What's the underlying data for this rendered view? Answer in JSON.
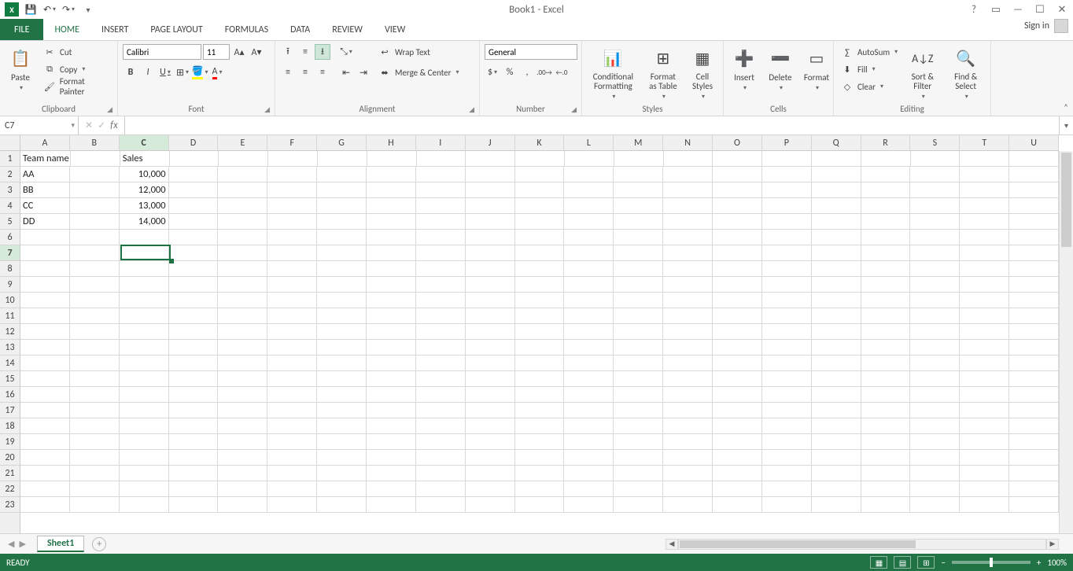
{
  "title": "Book1 - Excel",
  "qat": {
    "save": "💾",
    "undo": "↶",
    "redo": "↷"
  },
  "winbtns": {
    "help": "?",
    "ribbonopts": "▭",
    "min": "—",
    "max": "☐",
    "close": "✕"
  },
  "tabs": {
    "file": "FILE",
    "list": [
      "HOME",
      "INSERT",
      "PAGE LAYOUT",
      "FORMULAS",
      "DATA",
      "REVIEW",
      "VIEW"
    ],
    "active": "HOME"
  },
  "signin": "Sign in",
  "ribbon": {
    "clipboard": {
      "label": "Clipboard",
      "paste": "Paste",
      "cut": "Cut",
      "copy": "Copy",
      "painter": "Format Painter"
    },
    "font": {
      "label": "Font",
      "name": "Calibri",
      "size": "11",
      "bold": "B",
      "italic": "I",
      "underline": "U"
    },
    "alignment": {
      "label": "Alignment",
      "wrap": "Wrap Text",
      "merge": "Merge & Center"
    },
    "number": {
      "label": "Number",
      "format": "General"
    },
    "styles": {
      "label": "Styles",
      "cond": "Conditional Formatting",
      "table": "Format as Table",
      "cell": "Cell Styles"
    },
    "cells": {
      "label": "Cells",
      "insert": "Insert",
      "delete": "Delete",
      "format": "Format"
    },
    "editing": {
      "label": "Editing",
      "autosum": "AutoSum",
      "fill": "Fill",
      "clear": "Clear",
      "sort": "Sort & Filter",
      "find": "Find & Select"
    }
  },
  "namebox": "C7",
  "formula": "",
  "columns": [
    "A",
    "B",
    "C",
    "D",
    "E",
    "F",
    "G",
    "H",
    "I",
    "J",
    "K",
    "L",
    "M",
    "N",
    "O",
    "P",
    "Q",
    "R",
    "S",
    "T",
    "U"
  ],
  "selected_col_index": 2,
  "rows": 23,
  "selected_row_index": 6,
  "data": {
    "r1": {
      "A": "Team name",
      "C": "Sales"
    },
    "r2": {
      "A": "AA",
      "C": "10,000"
    },
    "r3": {
      "A": "BB",
      "C": "12,000"
    },
    "r4": {
      "A": "CC",
      "C": "13,000"
    },
    "r5": {
      "A": "DD",
      "C": "14,000"
    }
  },
  "active_cell": {
    "col": 2,
    "row": 6
  },
  "sheet": {
    "name": "Sheet1"
  },
  "status": {
    "ready": "READY",
    "zoom": "100%"
  }
}
